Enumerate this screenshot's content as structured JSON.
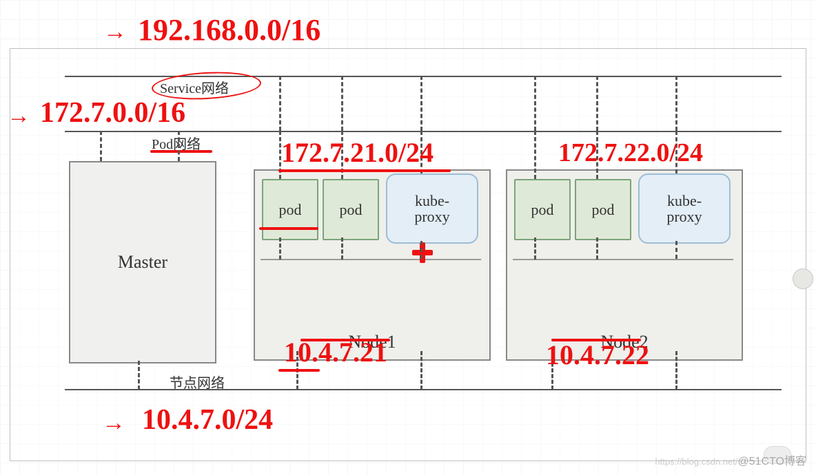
{
  "labels": {
    "service_network": "Service网络",
    "pod_network": "Pod网络",
    "node_network": "节点网络",
    "master": "Master",
    "node1": "Node1",
    "node2": "Node2",
    "pod": "pod",
    "kube_proxy": "kube-\nproxy"
  },
  "annotations": {
    "service_cidr": "192.168.0.0/16",
    "pod_cidr": "172.7.0.0/16",
    "node1_pod_cidr": "172.7.21.0/24",
    "node2_pod_cidr": "172.7.22.0/24",
    "node1_ip": "10.4.7.21",
    "node2_ip": "10.4.7.22",
    "node_cidr": "10.4.7.0/24"
  },
  "watermark": {
    "faint": "https://blog.csdn.net/",
    "main": "@51CTO博客"
  }
}
